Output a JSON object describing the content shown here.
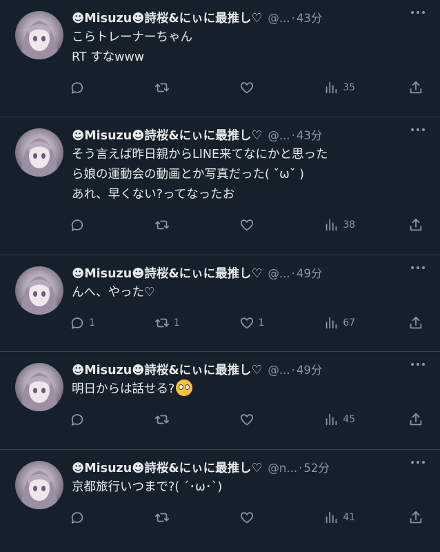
{
  "tweets": [
    {
      "name": "☻Misuzu☻詩桜&にぃに最推し♡",
      "handle": "@...",
      "time": "43分",
      "text": "こらトレーナーちゃん\nRT すなwww",
      "emoji": "",
      "replies": "",
      "retweets": "",
      "likes": "",
      "views": "35"
    },
    {
      "name": "☻Misuzu☻詩桜&にぃに最推し♡",
      "handle": "@...",
      "time": "43分",
      "text": "そう言えば昨日親からLINE来てなにかと思った\nら娘の運動会の動画とか写真だった( ˇωˇ )\nあれ、早くない?ってなったお",
      "emoji": "",
      "replies": "",
      "retweets": "",
      "likes": "",
      "views": "38"
    },
    {
      "name": "☻Misuzu☻詩桜&にぃに最推し♡",
      "handle": "@...",
      "time": "49分",
      "text": "んへ、やった♡",
      "emoji": "",
      "replies": "1",
      "retweets": "1",
      "likes": "1",
      "views": "67"
    },
    {
      "name": "☻Misuzu☻詩桜&にぃに最推し♡",
      "handle": "@...",
      "time": "49分",
      "text": "明日からは話せる?",
      "emoji": "pleading-face",
      "replies": "",
      "retweets": "",
      "likes": "",
      "views": "45"
    },
    {
      "name": "☻Misuzu☻詩桜&にぃに最推し♡",
      "handle": "@n...",
      "time": "52分",
      "text": "京都旅行いつまで?( ´･ω･`)",
      "emoji": "",
      "replies": "",
      "retweets": "",
      "likes": "",
      "views": "41"
    }
  ]
}
